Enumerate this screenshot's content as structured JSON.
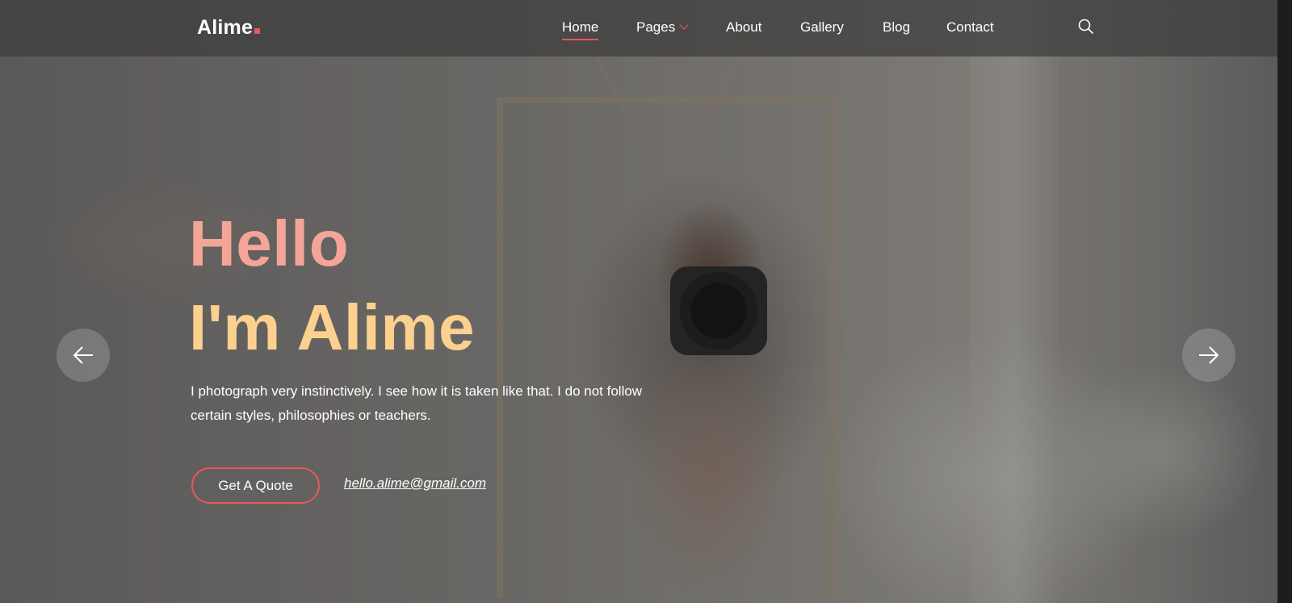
{
  "brand": {
    "name": "Alime",
    "accent_color": "#e8575a"
  },
  "nav": {
    "items": [
      {
        "label": "Home",
        "active": true
      },
      {
        "label": "Pages",
        "dropdown": true
      },
      {
        "label": "About"
      },
      {
        "label": "Gallery"
      },
      {
        "label": "Blog"
      },
      {
        "label": "Contact"
      }
    ],
    "search_icon": "search-icon"
  },
  "hero": {
    "title_line_1": "Hello",
    "title_line_2": "I'm Alime",
    "title_line_1_color": "#f4a597",
    "title_line_2_color": "#fcd08e",
    "description": "I photograph very instinctively. I see how it is taken like that. I do not follow certain styles, philosophies or teachers.",
    "cta_label": "Get A Quote",
    "email": "hello.alime@gmail.com"
  },
  "slider": {
    "prev_icon": "arrow-left-icon",
    "next_icon": "arrow-right-icon"
  }
}
